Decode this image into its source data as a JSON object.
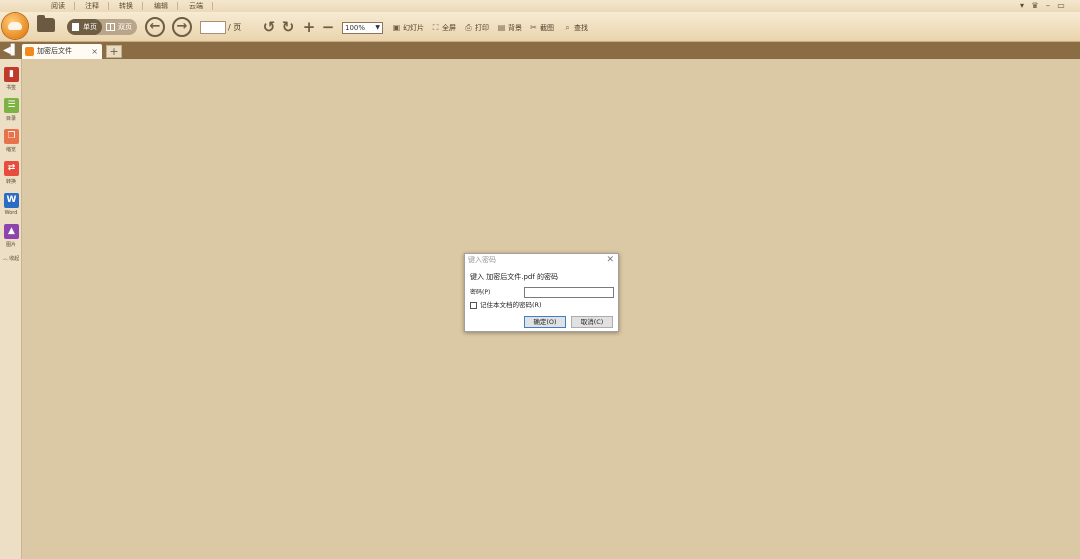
{
  "menu": {
    "tabs": [
      "阅读",
      "注释",
      "转换",
      "编辑",
      "云端"
    ]
  },
  "window_controls": [
    "▾",
    "♛",
    "–",
    "▭"
  ],
  "toolbar": {
    "single_page": "单页",
    "double_page": "双页",
    "page_suffix": "/ 页",
    "zoom": "100%",
    "slideshow": "幻灯片",
    "fullscreen": "全屏",
    "print": "打印",
    "background": "背景",
    "screenshot": "截图",
    "search": "查找"
  },
  "document_tab": {
    "title": "加密后文件"
  },
  "sidebar": {
    "items": [
      {
        "label": "书签",
        "icon": "bookmark-icon",
        "color": "#c0392b"
      },
      {
        "label": "目录",
        "icon": "toc-icon",
        "color": "#7cb342"
      },
      {
        "label": "缩览",
        "icon": "thumbnail-icon",
        "color": "#e8734a"
      },
      {
        "label": "转换",
        "icon": "convert-icon",
        "color": "#e74c3c"
      },
      {
        "label": "Word",
        "icon": "word-icon",
        "color": "#2b6cc4"
      },
      {
        "label": "图片",
        "icon": "image-icon",
        "color": "#8e44ad"
      }
    ],
    "collapse": "︿ 收起"
  },
  "dialog": {
    "title": "键入密码",
    "prompt": "键入 加密后文件.pdf 的密码",
    "password_label": "密码(P)",
    "password_value": "",
    "remember_label": "记住本文档的密码(R)",
    "ok": "确定(O)",
    "cancel": "取消(C)"
  },
  "colors": {
    "background": "#dbc8a4",
    "toolbar_brown": "#6f5d44",
    "tabbar": "#8a6d44",
    "accent_orange": "#e98a24"
  }
}
